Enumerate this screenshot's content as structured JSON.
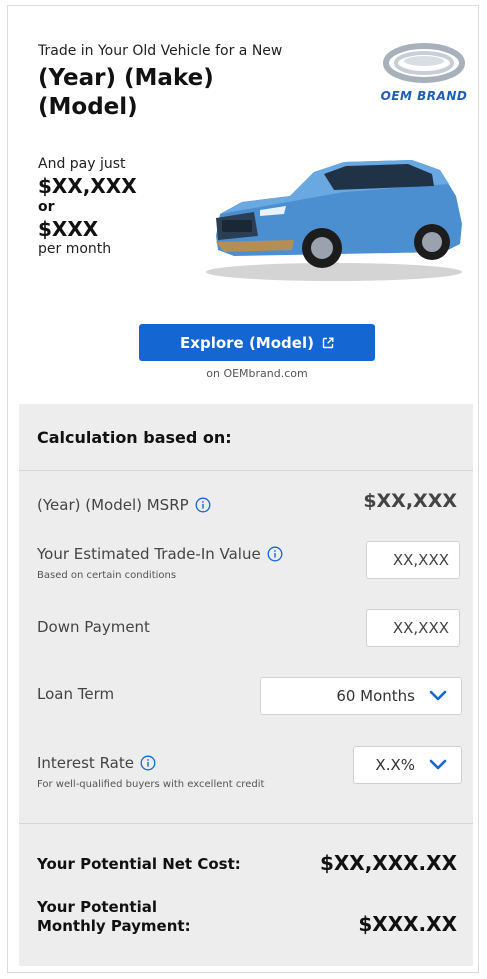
{
  "hero": {
    "intro": "Trade in Your Old Vehicle for a New",
    "title": "(Year) (Make) (Model)",
    "logo_text": "OEM BRAND",
    "pay_lead": "And pay just",
    "price_total": "$XX,XXX",
    "or_text": "or",
    "price_monthly": "$XXX",
    "per_month": "per month"
  },
  "cta": {
    "explore_label": "Explore (Model)",
    "site_text": "on OEMbrand.com"
  },
  "calc": {
    "heading": "Calculation based on:",
    "msrp_label": "(Year) (Model) MSRP",
    "msrp_value": "$XX,XXX",
    "trade_label": "Your Estimated Trade-In Value",
    "trade_sub": "Based on certain conditions",
    "trade_value": "XX,XXX",
    "down_label": "Down Payment",
    "down_value": "XX,XXX",
    "term_label": "Loan Term",
    "term_value": "60 Months",
    "rate_label": "Interest Rate",
    "rate_sub": "For well-qualified buyers with excellent credit",
    "rate_value": "X.X%",
    "net_label": "Your Potential Net Cost:",
    "net_value": "$XX,XXX.XX",
    "monthly_label_1": "Your Potential",
    "monthly_label_2": "Monthly Payment:",
    "monthly_value": "$XXX.XX"
  },
  "colors": {
    "accent": "#1467d2",
    "panel": "#ededed"
  },
  "icons": [
    "oem-brand-logo-icon",
    "external-link-icon",
    "info-icon",
    "chevron-down-icon"
  ]
}
